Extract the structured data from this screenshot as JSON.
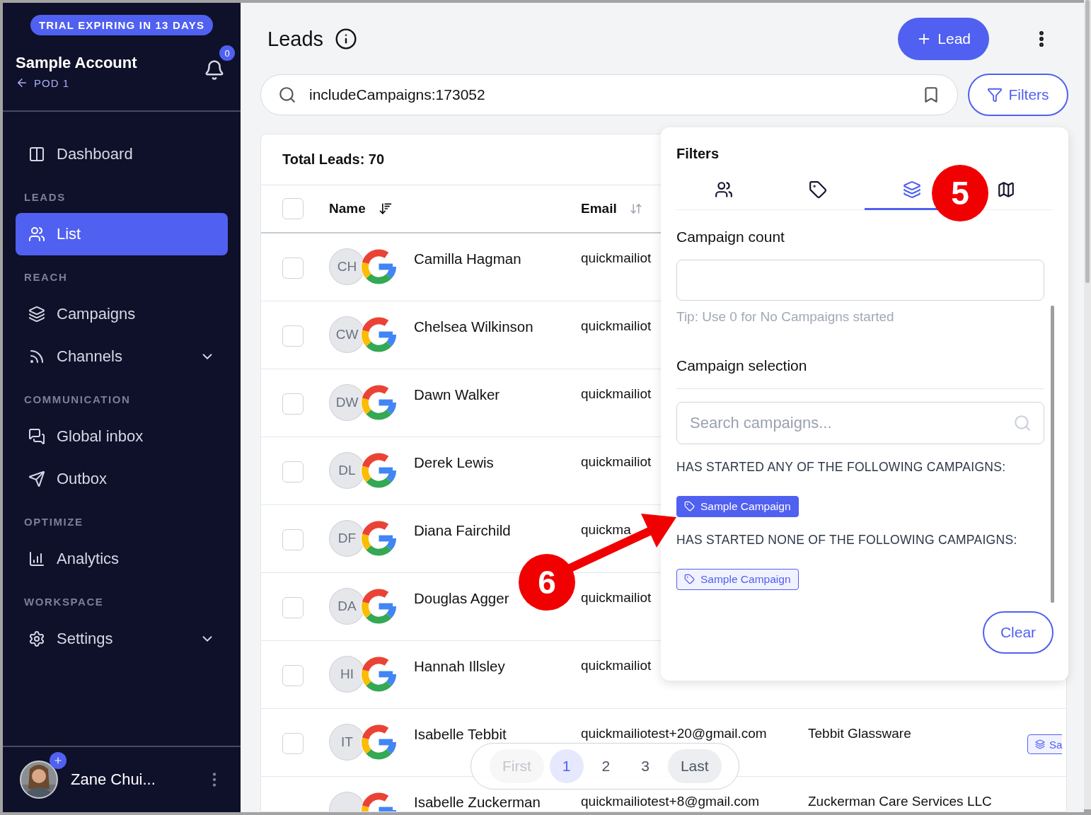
{
  "trial_banner": "TRIAL EXPIRING IN 13 DAYS",
  "account": {
    "name": "Sample Account",
    "pod": "POD 1",
    "notifications": "0"
  },
  "nav": [
    {
      "kind": "item",
      "label": "Dashboard",
      "selected": false,
      "expandable": false
    },
    {
      "kind": "section",
      "label": "LEADS"
    },
    {
      "kind": "item",
      "label": "List",
      "selected": true,
      "expandable": false
    },
    {
      "kind": "section",
      "label": "REACH"
    },
    {
      "kind": "item",
      "label": "Campaigns",
      "selected": false,
      "expandable": false
    },
    {
      "kind": "item",
      "label": "Channels",
      "selected": false,
      "expandable": true
    },
    {
      "kind": "section",
      "label": "COMMUNICATION"
    },
    {
      "kind": "item",
      "label": "Global inbox",
      "selected": false,
      "expandable": false
    },
    {
      "kind": "item",
      "label": "Outbox",
      "selected": false,
      "expandable": false
    },
    {
      "kind": "section",
      "label": "OPTIMIZE"
    },
    {
      "kind": "item",
      "label": "Analytics",
      "selected": false,
      "expandable": false
    },
    {
      "kind": "section",
      "label": "WORKSPACE"
    },
    {
      "kind": "item",
      "label": "Settings",
      "selected": false,
      "expandable": true
    }
  ],
  "user": {
    "name": "Zane Chui..."
  },
  "page": {
    "title": "Leads",
    "new_button": "Lead"
  },
  "search": {
    "value": "includeCampaigns:173052"
  },
  "filters_button": "Filters",
  "table": {
    "total": "Total Leads: 70",
    "select_all": {
      "checked": false
    },
    "columns": [
      {
        "label": "Name"
      },
      {
        "label": "Email"
      }
    ],
    "rows": [
      {
        "checked": false,
        "initials": "CH",
        "name": "Camilla Hagman",
        "email": "quickmailiot"
      },
      {
        "checked": false,
        "initials": "CW",
        "name": "Chelsea Wilkinson",
        "email": "quickmailiot"
      },
      {
        "checked": false,
        "initials": "DW",
        "name": "Dawn Walker",
        "email": "quickmailiot"
      },
      {
        "checked": false,
        "initials": "DL",
        "name": "Derek Lewis",
        "email": "quickmailiot"
      },
      {
        "checked": false,
        "initials": "DF",
        "name": "Diana Fairchild",
        "email": "quickma"
      },
      {
        "checked": false,
        "initials": "DA",
        "name": "Douglas Agger",
        "email": "quickmailiot"
      },
      {
        "checked": false,
        "initials": "HI",
        "name": "Hannah Illsley",
        "email": "quickmailiot"
      },
      {
        "checked": false,
        "initials": "IT",
        "name": "Isabelle Tebbit",
        "email": "quickmailiotest+20@gmail.com",
        "company": "Tebbit Glassware",
        "tag": "Sa"
      },
      {
        "name": "Isabelle Zuckerman",
        "email": "quickmailiotest+8@gmail.com",
        "company": "Zuckerman Care Services LLC"
      }
    ]
  },
  "pagination": [
    {
      "kind": "edge",
      "label": "First",
      "disabled": true,
      "selected": false
    },
    {
      "kind": "page",
      "label": "1",
      "disabled": false,
      "selected": true
    },
    {
      "kind": "page",
      "label": "2",
      "disabled": false,
      "selected": false
    },
    {
      "kind": "page",
      "label": "3",
      "disabled": false,
      "selected": false
    },
    {
      "kind": "edge",
      "label": "Last",
      "disabled": false,
      "selected": false
    }
  ],
  "filters_panel": {
    "title": "Filters",
    "tabs": [
      {
        "selected": false
      },
      {
        "selected": false
      },
      {
        "selected": true
      },
      {
        "selected": false
      }
    ],
    "count_label": "Campaign count",
    "tip": "Tip: Use 0 for No Campaigns started",
    "selection_label": "Campaign selection",
    "search_placeholder": "Search campaigns...",
    "groups": [
      {
        "heading": "HAS STARTED ANY OF THE FOLLOWING CAMPAIGNS:",
        "tags": [
          {
            "label": "Sample Campaign",
            "kind": "filled"
          }
        ]
      },
      {
        "heading": "HAS STARTED NONE OF THE FOLLOWING CAMPAIGNS:",
        "tags": [
          {
            "label": "Sample Campaign",
            "kind": "outline"
          }
        ]
      }
    ],
    "clear_button": "Clear"
  },
  "annotations": [
    {
      "label": "5"
    },
    {
      "label": "6"
    }
  ]
}
